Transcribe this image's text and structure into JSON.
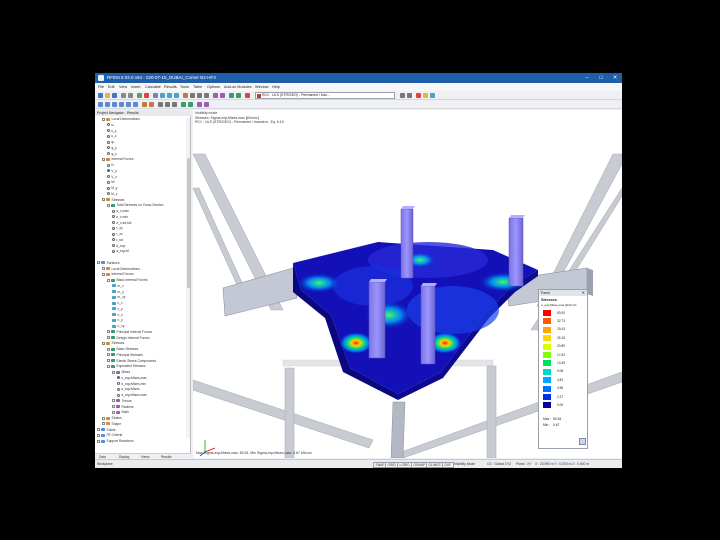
{
  "window": {
    "title": "RFEM 6.02.0 x64 - 220-07-15_DUBAI_Corner B2-HF3",
    "minimize": "–",
    "maximize": "□",
    "close": "✕"
  },
  "menu": [
    "File",
    "Edit",
    "View",
    "Insert",
    "Calculate",
    "Results",
    "Tools",
    "Table",
    "Options",
    "Add-on Modules",
    "Window",
    "Help"
  ],
  "toolbar": {
    "load_case": "RC1 · ULS (STR/GEO) - Permanent / tran..."
  },
  "navigator": {
    "header": "Project Navigator - Results",
    "tabs": [
      "Data",
      "Display",
      "Views",
      "Results"
    ],
    "tree": [
      {
        "label": "Local Deformations",
        "level": 1,
        "kind": "folder"
      },
      {
        "label": "uₓ",
        "level": 2,
        "kind": "radio"
      },
      {
        "label": "u_y",
        "level": 2,
        "kind": "radio"
      },
      {
        "label": "u_z",
        "level": 2,
        "kind": "radio"
      },
      {
        "label": "φₓ",
        "level": 2,
        "kind": "radio"
      },
      {
        "label": "φ_y",
        "level": 2,
        "kind": "radio"
      },
      {
        "label": "φ_z",
        "level": 2,
        "kind": "radio"
      },
      {
        "label": "Internal Forces",
        "level": 1,
        "kind": "folder"
      },
      {
        "label": "N",
        "level": 2,
        "kind": "radio"
      },
      {
        "label": "V_y",
        "level": 2,
        "kind": "radio-on"
      },
      {
        "label": "V_z",
        "level": 2,
        "kind": "radio"
      },
      {
        "label": "Mₜ",
        "level": 2,
        "kind": "radio"
      },
      {
        "label": "M_y",
        "level": 2,
        "kind": "radio"
      },
      {
        "label": "M_z",
        "level": 2,
        "kind": "radio"
      },
      {
        "label": "Stresses",
        "level": 1,
        "kind": "folder"
      },
      {
        "label": "Total Stresses on Cross-Section",
        "level": 2,
        "kind": "folder"
      },
      {
        "label": "σ_x,max",
        "level": 3,
        "kind": "radio"
      },
      {
        "label": "σ_x,min",
        "level": 3,
        "kind": "radio"
      },
      {
        "label": "σ_x,tot,full",
        "level": 3,
        "kind": "radio"
      },
      {
        "label": "τ_xy",
        "level": 3,
        "kind": "radio"
      },
      {
        "label": "τ_xz",
        "level": 3,
        "kind": "radio"
      },
      {
        "label": "τ_tot",
        "level": 3,
        "kind": "radio"
      },
      {
        "label": "σ_eqv",
        "level": 3,
        "kind": "radio"
      },
      {
        "label": "σ_eqv,M",
        "level": 3,
        "kind": "radio"
      },
      {
        "label": "",
        "level": 0,
        "kind": "space"
      },
      {
        "label": "Surfaces",
        "level": 0,
        "kind": "folder"
      },
      {
        "label": "Local Deformations",
        "level": 1,
        "kind": "folder"
      },
      {
        "label": "Internal Forces",
        "level": 1,
        "kind": "folder"
      },
      {
        "label": "Basic Internal Forces",
        "level": 2,
        "kind": "folder"
      },
      {
        "label": "m_x",
        "level": 3,
        "kind": "item"
      },
      {
        "label": "m_y",
        "level": 3,
        "kind": "item"
      },
      {
        "label": "m_xy",
        "level": 3,
        "kind": "item"
      },
      {
        "label": "v_x",
        "level": 3,
        "kind": "item"
      },
      {
        "label": "v_y",
        "level": 3,
        "kind": "item"
      },
      {
        "label": "n_x",
        "level": 3,
        "kind": "item"
      },
      {
        "label": "n_y",
        "level": 3,
        "kind": "item"
      },
      {
        "label": "n_xy",
        "level": 3,
        "kind": "item"
      },
      {
        "label": "Principal Internal Forces",
        "level": 2,
        "kind": "folder"
      },
      {
        "label": "Design Internal Forces",
        "level": 2,
        "kind": "folder"
      },
      {
        "label": "Stresses",
        "level": 1,
        "kind": "folder"
      },
      {
        "label": "Basic Stresses",
        "level": 2,
        "kind": "folder"
      },
      {
        "label": "Principal Stresses",
        "level": 2,
        "kind": "folder"
      },
      {
        "label": "Elastic Stress Components",
        "level": 2,
        "kind": "folder"
      },
      {
        "label": "Equivalent Stresses",
        "level": 2,
        "kind": "folder"
      },
      {
        "label": "Mises",
        "level": 3,
        "kind": "folder"
      },
      {
        "label": "σ_eqv,Mises,max",
        "level": 4,
        "kind": "radio-on"
      },
      {
        "label": "σ_eqv,Mises,min",
        "level": 4,
        "kind": "radio"
      },
      {
        "label": "σ_eqv,Mises",
        "level": 4,
        "kind": "radio"
      },
      {
        "label": "σ_eqv,Mises,max",
        "level": 4,
        "kind": "radio"
      },
      {
        "label": "Tresca",
        "level": 3,
        "kind": "folder"
      },
      {
        "label": "Rankine",
        "level": 3,
        "kind": "folder"
      },
      {
        "label": "Bach",
        "level": 3,
        "kind": "folder"
      },
      {
        "label": "Strains",
        "level": 1,
        "kind": "folder"
      },
      {
        "label": "Shape",
        "level": 1,
        "kind": "folder"
      },
      {
        "label": "Solids",
        "level": 0,
        "kind": "folder"
      },
      {
        "label": "FE Criteria",
        "level": 0,
        "kind": "folder"
      },
      {
        "label": "Support Reactions",
        "level": 0,
        "kind": "folder"
      }
    ]
  },
  "viewport": {
    "info_lines": [
      "Visibility mode",
      "Stresses: Sigma-eqv,Mises,max [kN/cm²]",
      "RC1 · ULS (STR/GEO) - Permanent / transient - Eq. 6.10"
    ],
    "footer": "Max Sigma-eqv,Mises,max: 50.54, Min Sigma-eqv,Mises,max: 0.67 kN/cm²"
  },
  "legend_panel": {
    "header": "Panel",
    "title": "Stresses",
    "subtitle": "σ_eqv,Mises,max [kN/cm²]",
    "values": [
      "50.00",
      "32.73",
      "29.43",
      "25.15",
      "20.89",
      "17.62",
      "13.35",
      "9.08",
      "4.81",
      "3.55",
      "2.27",
      "0.00"
    ],
    "colors": [
      "#ff0000",
      "#ff5a00",
      "#ffa500",
      "#ffd700",
      "#d9ff00",
      "#7fff00",
      "#00e060",
      "#00d8c8",
      "#00a8ff",
      "#0070ff",
      "#0030e0",
      "#0000a0"
    ],
    "max_label": "Max :",
    "max_value": "50.54",
    "min_label": "Min :",
    "min_value": "0.67"
  },
  "statusbar": {
    "left": "Workplane",
    "items": [
      "SNAP",
      "GRID",
      "LGRID",
      "OSNAP",
      "GLINES",
      "DXF",
      "Visibility Mode",
      "CS : Global XYZ",
      "Plane : XY"
    ],
    "coords": "X : 23.990 m   Y : 0.000 m   Z : 0.000 m"
  },
  "colors": {
    "titlebar": "#1f5ea8",
    "accent": "#1f5ea8"
  }
}
